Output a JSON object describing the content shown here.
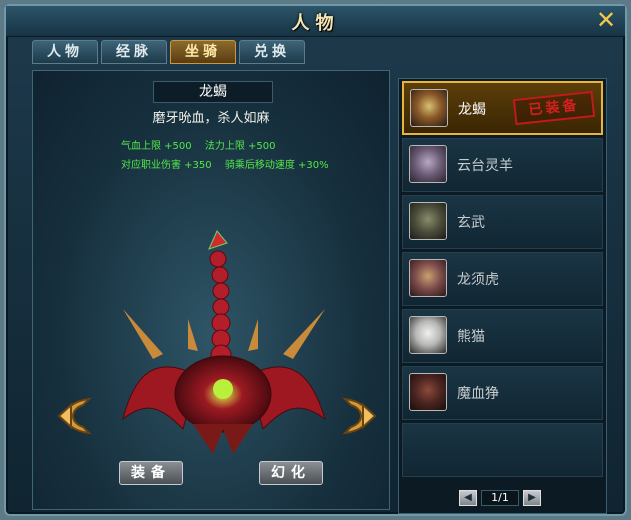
{
  "window": {
    "title": "人物",
    "close_icon": "close-icon"
  },
  "tabs": [
    {
      "label": "人物",
      "active": false
    },
    {
      "label": "经脉",
      "active": false
    },
    {
      "label": "坐骑",
      "active": true
    },
    {
      "label": "兑换",
      "active": false
    }
  ],
  "detail": {
    "name": "龙蝎",
    "description": "磨牙吮血，杀人如麻",
    "stats": [
      "气血上限 +500",
      "法力上限 +500",
      "对应职业伤害 +350",
      "骑乘后移动速度 +30%"
    ],
    "equip_button": "装备",
    "transform_button": "幻化",
    "prev_icon": "arrow-left-icon",
    "next_icon": "arrow-right-icon"
  },
  "mounts": [
    {
      "name": "龙蝎",
      "selected": true,
      "equipped_label": "已装备"
    },
    {
      "name": "云台灵羊",
      "selected": false
    },
    {
      "name": "玄武",
      "selected": false
    },
    {
      "name": "龙须虎",
      "selected": false
    },
    {
      "name": "熊猫",
      "selected": false
    },
    {
      "name": "魔血狰",
      "selected": false
    }
  ],
  "pager": {
    "text": "1/1",
    "prev_icon": "page-prev-icon",
    "next_icon": "page-next-icon"
  },
  "colors": {
    "accent": "#e9b43c",
    "stat_text": "#54e84a",
    "stamp": "#c21a1a"
  }
}
